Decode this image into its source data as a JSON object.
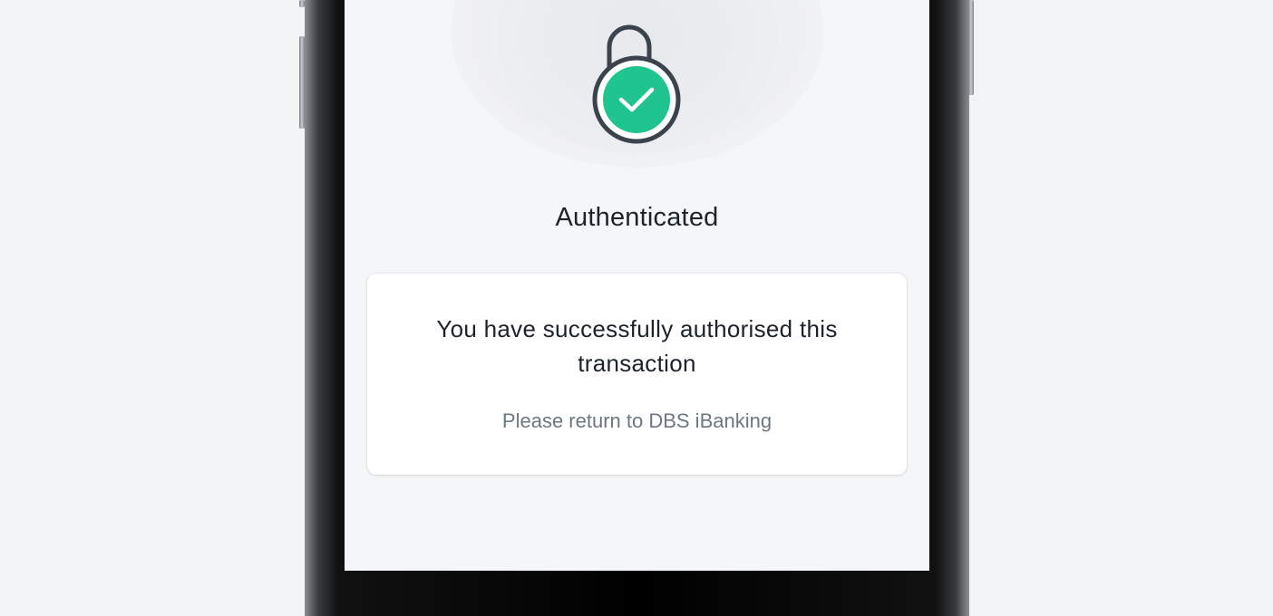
{
  "status": {
    "title": "Authenticated"
  },
  "card": {
    "message": "You have successfully authorised this transaction",
    "instruction": "Please return to DBS iBanking"
  },
  "icons": {
    "status_icon": "unlocked-padlock-check-icon"
  },
  "colors": {
    "success_green": "#1fc48f",
    "lock_stroke": "#3b434c",
    "screen_background": "#f5f6f8",
    "card_background": "#ffffff",
    "title_text": "#1c232b",
    "secondary_text": "#6d7782"
  }
}
